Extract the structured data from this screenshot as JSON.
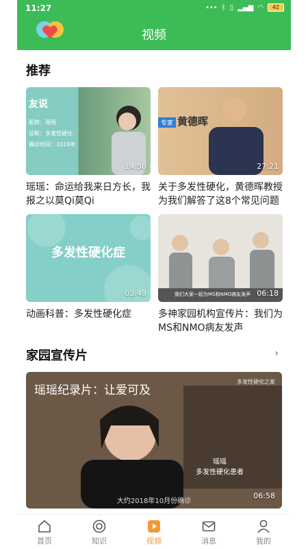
{
  "status": {
    "time": "11:27",
    "battery": "42",
    "icons": [
      "more-icon",
      "bluetooth-icon",
      "vibrate-icon",
      "signal-icon",
      "wifi-icon",
      "battery-icon"
    ]
  },
  "header": {
    "title": "视频",
    "accent": "#3cbc57"
  },
  "recommend": {
    "title": "推荐",
    "videos": [
      {
        "caption": "瑶瑶：命运给我来日方长，我报之以莫Qi莫Qi",
        "duration": "14:50",
        "overlay_lines": [
          "友说",
          "昵称：瑶瑶",
          "诊断：多发性硬化",
          "确诊时间：2018年"
        ]
      },
      {
        "caption": "关于多发性硬化，黄德晖教授为我们解答了这8个常见问题",
        "duration": "27:21",
        "overlay_lines": [
          "专家",
          "黄德晖"
        ]
      },
      {
        "caption": "动画科普：多发性硬化症",
        "duration": "03:49",
        "overlay_lines": [
          "多发性硬化症"
        ]
      },
      {
        "caption": "多神家园机构宣传片：我们为MS和NMO病友发声",
        "duration": "06:18",
        "overlay_lines": [
          "我们大家一起为MS和NMO病友发声"
        ]
      }
    ]
  },
  "promo_section": {
    "title": "家园宣传片",
    "video": {
      "title": "瑶瑶纪录片：让爱可及",
      "brand": "多发性硬化之家",
      "vertical_text": [
        "瑶瑶",
        "多发性硬化患者"
      ],
      "subtitle": "大约2018年10月份确诊",
      "duration": "06:58"
    }
  },
  "nav": [
    {
      "label": "首页",
      "icon": "home-icon",
      "active": false
    },
    {
      "label": "知识",
      "icon": "knowledge-icon",
      "active": false
    },
    {
      "label": "视频",
      "icon": "video-icon",
      "active": true
    },
    {
      "label": "消息",
      "icon": "message-icon",
      "active": false
    },
    {
      "label": "我的",
      "icon": "profile-icon",
      "active": false
    }
  ],
  "colors": {
    "active": "#f29a3b",
    "inactive": "#888888"
  }
}
